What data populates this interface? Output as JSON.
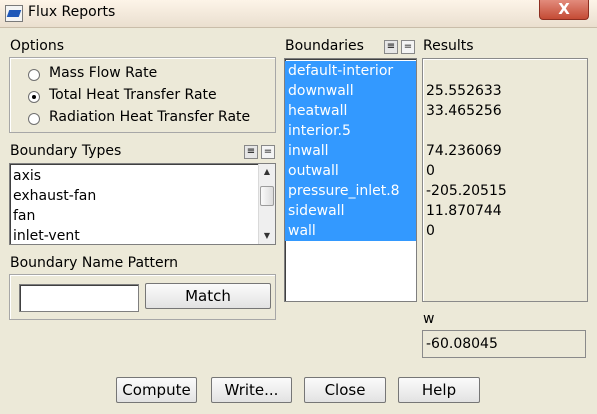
{
  "window": {
    "title": "Flux Reports",
    "close_glyph": "X"
  },
  "options": {
    "label": "Options",
    "items": [
      {
        "label": "Mass Flow Rate",
        "selected": false
      },
      {
        "label": "Total Heat Transfer Rate",
        "selected": true
      },
      {
        "label": "Radiation Heat Transfer Rate",
        "selected": false
      }
    ]
  },
  "boundary_types": {
    "label": "Boundary Types",
    "items": [
      "axis",
      "exhaust-fan",
      "fan",
      "inlet-vent"
    ]
  },
  "name_pattern": {
    "label": "Boundary Name Pattern",
    "value": "",
    "match_label": "Match"
  },
  "boundaries": {
    "label": "Boundaries",
    "items": [
      "default-interior",
      "downwall",
      "heatwall",
      "interior.5",
      "inwall",
      "outwall",
      "pressure_inlet.8",
      "sidewall",
      "wall"
    ]
  },
  "results": {
    "label": "Results",
    "values": [
      "",
      "25.552633",
      "33.465256",
      "",
      "74.236069",
      "0",
      "-205.20515",
      "11.870744",
      "0"
    ]
  },
  "total": {
    "unit": "w",
    "value": "-60.08045"
  },
  "buttons": {
    "compute": "Compute",
    "write": "Write...",
    "close": "Close",
    "help": "Help"
  },
  "icons": {
    "select_all": "≡",
    "deselect_all": "="
  }
}
